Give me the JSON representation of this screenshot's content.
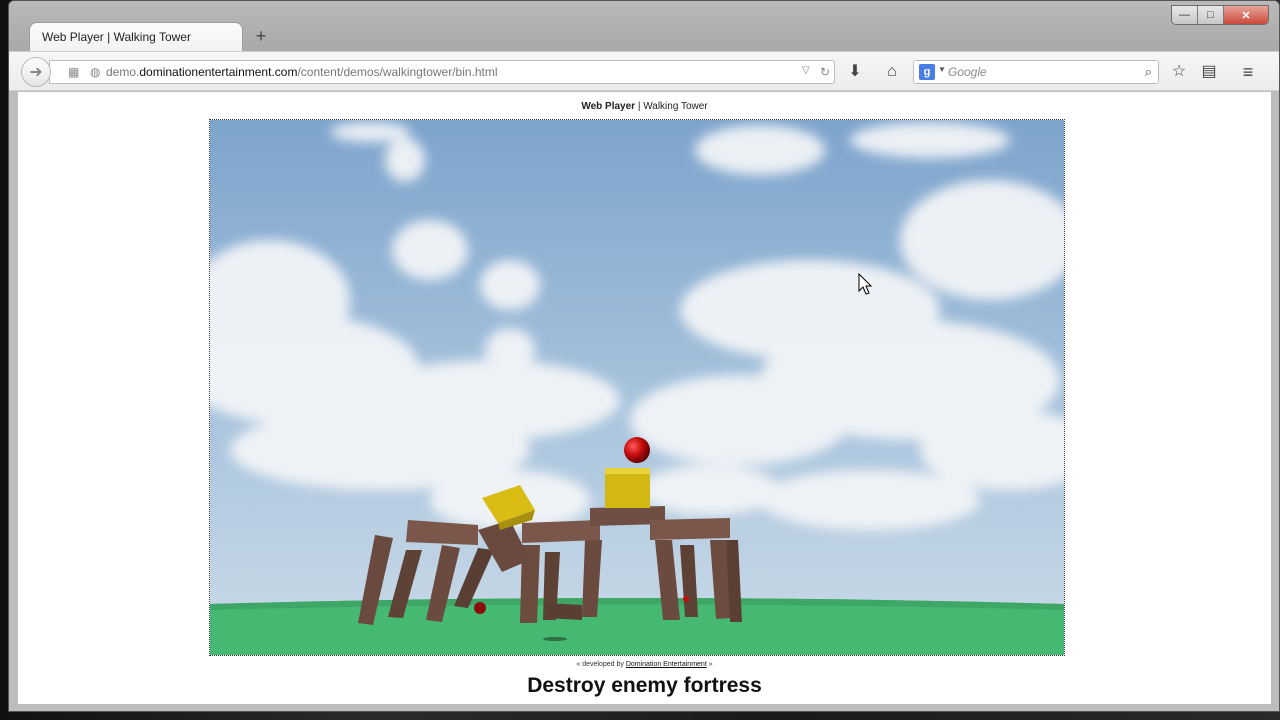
{
  "browser": {
    "tab_title": "Web Player | Walking Tower",
    "new_tab_symbol": "+",
    "url_prefix": "demo.",
    "url_domain": "dominationentertainment.com",
    "url_path": "/content/demos/walkingtower/bin.html",
    "search_placeholder": "Google",
    "window_controls": {
      "minimize": "—",
      "maximize": "□",
      "close": "✕"
    }
  },
  "page": {
    "header_bold": "Web Player",
    "header_sep": " | ",
    "header_rest": "Walking Tower",
    "credit_prefix": "« developed by ",
    "credit_link": "Domination Entertainment",
    "credit_suffix": " »",
    "headline": "Destroy enemy fortress"
  },
  "colors": {
    "sky_top": "#7fa6cf",
    "sky_bottom": "#c6d8e8",
    "ground": "#45b872",
    "wood": "#6a4a3e",
    "block_yellow": "#d4b812",
    "ball_red": "#c40d0d"
  },
  "icons": {
    "back": "arrow-left",
    "reload": "reload",
    "download": "download-arrow",
    "home": "house",
    "bookmark": "star",
    "reading": "clipboard",
    "menu": "hamburger"
  }
}
